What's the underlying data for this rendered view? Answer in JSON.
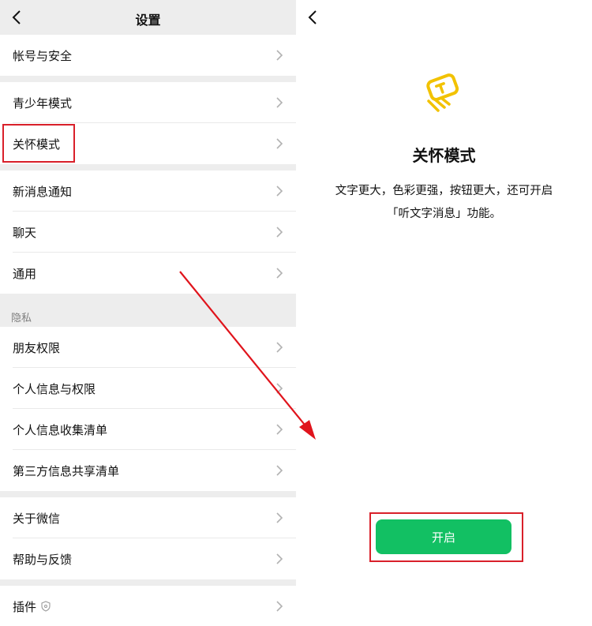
{
  "settings": {
    "title": "设置",
    "groups": [
      {
        "items": [
          "帐号与安全"
        ]
      },
      {
        "items": [
          "青少年模式",
          "关怀模式"
        ]
      },
      {
        "items": [
          "新消息通知",
          "聊天",
          "通用"
        ]
      }
    ],
    "privacy_section_label": "隐私",
    "privacy_items": [
      "朋友权限",
      "个人信息与权限",
      "个人信息收集清单",
      "第三方信息共享清单"
    ],
    "about_items": [
      "关于微信",
      "帮助与反馈"
    ],
    "plugins_label": "插件"
  },
  "care_mode": {
    "title": "关怀模式",
    "description_line1": "文字更大，色彩更强，按钮更大，还可开启",
    "description_line2": "「听文字消息」功能。",
    "enable_button": "开启"
  },
  "colors": {
    "accent_green": "#12c063",
    "highlight_red": "#d9202a",
    "icon_yellow": "#f2c200"
  },
  "icons": {
    "back": "chevron-left-icon",
    "chevron": "chevron-right-icon",
    "care": "care-mode-icon",
    "plugin_badge": "shield-icon"
  }
}
